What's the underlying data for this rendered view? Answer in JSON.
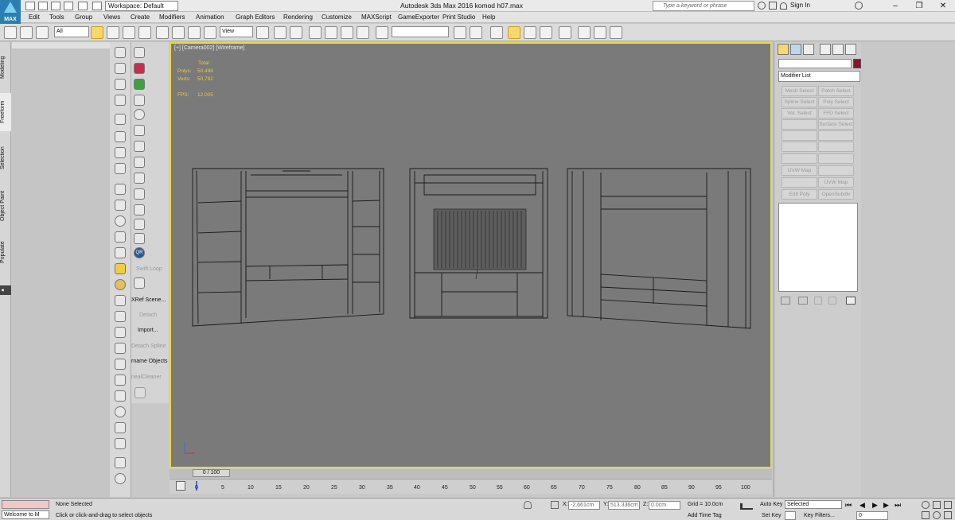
{
  "app": {
    "logo_text": "MAX",
    "window_title": "Autodesk 3ds Max 2016     komod h07.max",
    "workspace": "Workspace: Default"
  },
  "search": {
    "placeholder": "Type a keyword or phrase"
  },
  "account": {
    "sign_in": "Sign In"
  },
  "menu": [
    "Edit",
    "Tools",
    "Group",
    "Views",
    "Create",
    "Modifiers",
    "Animation",
    "Graph Editors",
    "Rendering",
    "Customize",
    "MAXScript",
    "GameExporter",
    "Print Studio",
    "Help"
  ],
  "toolbar": {
    "selection_filter": "All",
    "ref_coord": "View"
  },
  "left_tabs": [
    "Modeling",
    "Freeform",
    "Selection",
    "Object Paint",
    "Populate"
  ],
  "tools_panel": {
    "items": [
      "Swift Loop",
      "XRef Scene...",
      "Detach",
      "Import...",
      "Detach Spline",
      "rname Objects",
      "nealCleaner"
    ],
    "qr_label": "QR"
  },
  "viewport": {
    "label": "[+] [Camera002] [Wireframe]",
    "stats": {
      "total_label": "Total",
      "polys_label": "Polys:",
      "polys": "50,498",
      "verts_label": "Verts:",
      "verts": "50,782",
      "fps_label": "FPS:",
      "fps": "12.005"
    }
  },
  "timeline": {
    "frame": "0 / 100",
    "ticks": [
      "0",
      "5",
      "10",
      "15",
      "20",
      "25",
      "30",
      "35",
      "40",
      "45",
      "50",
      "55",
      "60",
      "65",
      "70",
      "75",
      "80",
      "85",
      "90",
      "95",
      "100"
    ]
  },
  "command_panel": {
    "modifier_list": "Modifier List",
    "buttons": [
      "Mesh Select",
      "Patch Select",
      "Spline Select",
      "Poly Select",
      "Vol. Select",
      "FFD Select",
      "",
      "Surface Select",
      "",
      "",
      "",
      "",
      "",
      "",
      "UVW Map",
      "",
      "",
      "UVW Map",
      "Edit Poly",
      "OpenSubdiv"
    ]
  },
  "status": {
    "script_label": "Welcome to M",
    "selection": "None Selected",
    "prompt": "Click or click-and-drag to select objects",
    "x_label": "X:",
    "x": "-2.661cm",
    "y_label": "Y:",
    "y": "513.336cm",
    "z_label": "Z:",
    "z": "0.0cm",
    "grid": "Grid = 10.0cm",
    "add_time_tag": "Add Time Tag",
    "auto_key": "Auto Key",
    "set_key": "Set Key",
    "key_mode": "Selected",
    "key_filters": "Key Filters...",
    "current_frame": "0"
  },
  "colors": {
    "viewport_bg": "#7a7a7a",
    "active_border": "#e6d84a",
    "stats": "#e8c840",
    "swatch": "#8a1530"
  }
}
